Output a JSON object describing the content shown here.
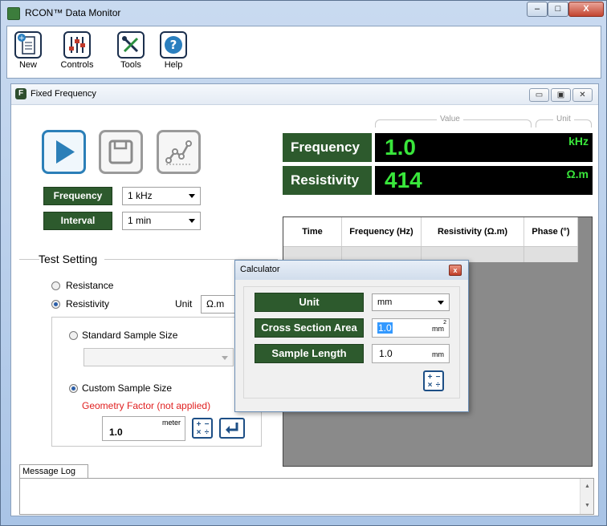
{
  "window": {
    "title": "RCON™ Data Monitor",
    "minimize": "–",
    "maximize": "□",
    "close": "X"
  },
  "toolbar": {
    "items": [
      {
        "label": "New",
        "icon": "new-document-icon"
      },
      {
        "label": "Controls",
        "icon": "sliders-icon"
      },
      {
        "label": "Tools",
        "icon": "tools-icon"
      },
      {
        "label": "Help",
        "icon": "help-icon"
      }
    ]
  },
  "child": {
    "title": "Fixed Frequency",
    "icon_letter": "F"
  },
  "controls": {
    "frequency_label": "Frequency",
    "frequency_value": "1 kHz",
    "interval_label": "Interval",
    "interval_value": "1 min"
  },
  "display": {
    "value_header": "Value",
    "unit_header": "Unit",
    "rows": [
      {
        "label": "Frequency",
        "value": "1.0",
        "unit": "kHz"
      },
      {
        "label": "Resistivity",
        "value": "414",
        "unit": "Ω.m"
      }
    ]
  },
  "test_setting": {
    "title": "Test Setting",
    "resistance": "Resistance",
    "resistivity": "Resistivity",
    "unit_label": "Unit",
    "unit_value": "Ω.m",
    "standard_size": "Standard Sample Size",
    "custom_size": "Custom Sample Size",
    "geometry_note": "Geometry Factor (not applied)",
    "geometry_value": "1.0",
    "geometry_unit": "meter"
  },
  "table": {
    "columns": [
      "Time",
      "Frequency (Hz)",
      "Resistivity (Ω.m)",
      "Phase (°)"
    ]
  },
  "calculator": {
    "title": "Calculator",
    "unit_label": "Unit",
    "unit_value": "mm",
    "area_label": "Cross Section Area",
    "area_value": "1.0",
    "area_unit": "mm",
    "area_sup": "2",
    "length_label": "Sample Length",
    "length_value": "1.0",
    "length_unit": "mm"
  },
  "message_log": {
    "tab": "Message Log"
  },
  "colors": {
    "green_label": "#2d5a2d",
    "readout_green": "#39e63b",
    "alert_red": "#e02020"
  }
}
